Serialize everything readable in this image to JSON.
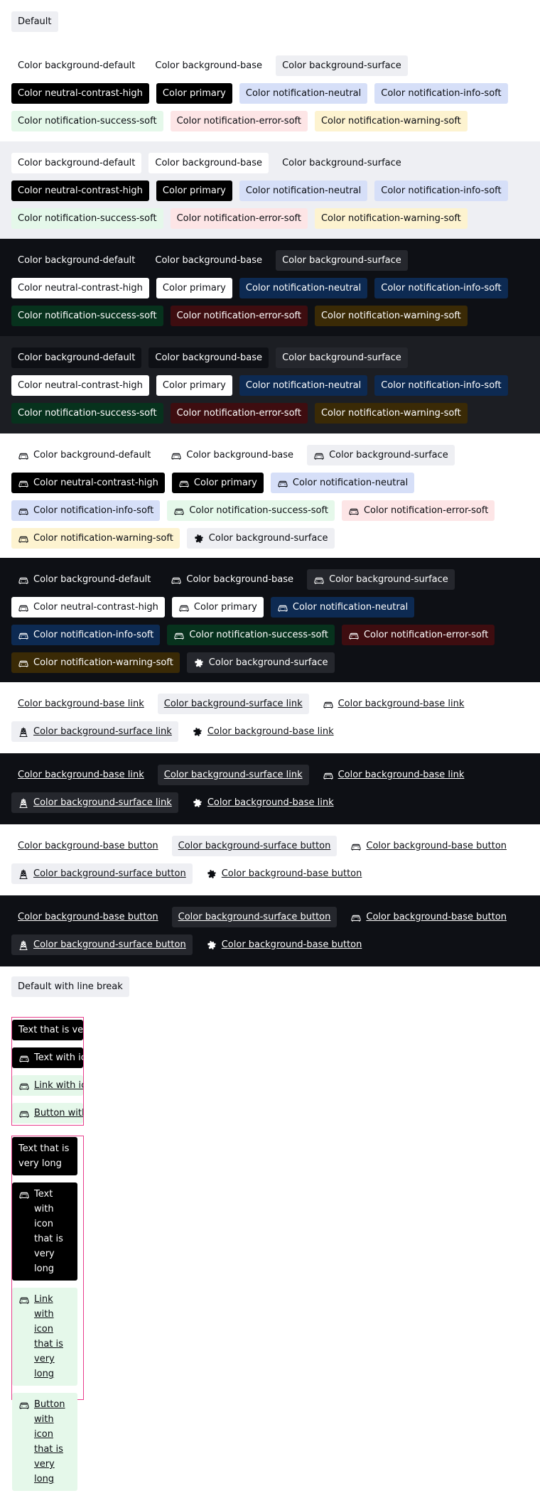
{
  "default_tag": "Default",
  "tags": {
    "bg_default": "Color background-default",
    "bg_base": "Color background-base",
    "bg_surface": "Color background-surface",
    "neutral_contrast": "Color neutral-contrast-high",
    "primary": "Color primary",
    "notif_neutral": "Color notification-neutral",
    "notif_info": "Color notification-info-soft",
    "notif_success": "Color notification-success-soft",
    "notif_error": "Color notification-error-soft",
    "notif_warning": "Color notification-warning-soft"
  },
  "links": {
    "base": "Color background-base link",
    "surface": "Color background-surface link"
  },
  "buttons": {
    "base": "Color background-base button",
    "surface": "Color background-surface button"
  },
  "line_break_tag": "Default with line break",
  "long": {
    "text": "Text that is very long",
    "text_icon": "Text with icon that is very long",
    "link_icon": "Link with icon that is very long",
    "button_icon": "Button with icon that is very long"
  },
  "colors": {
    "surface_light": "#eeeff3",
    "dark_bg": "#0e1015",
    "dark_alt_bg": "#1c1e23",
    "focus_outline": "#e83e8c"
  },
  "icons": [
    "car-icon",
    "puzzle-icon",
    "tower-icon"
  ]
}
